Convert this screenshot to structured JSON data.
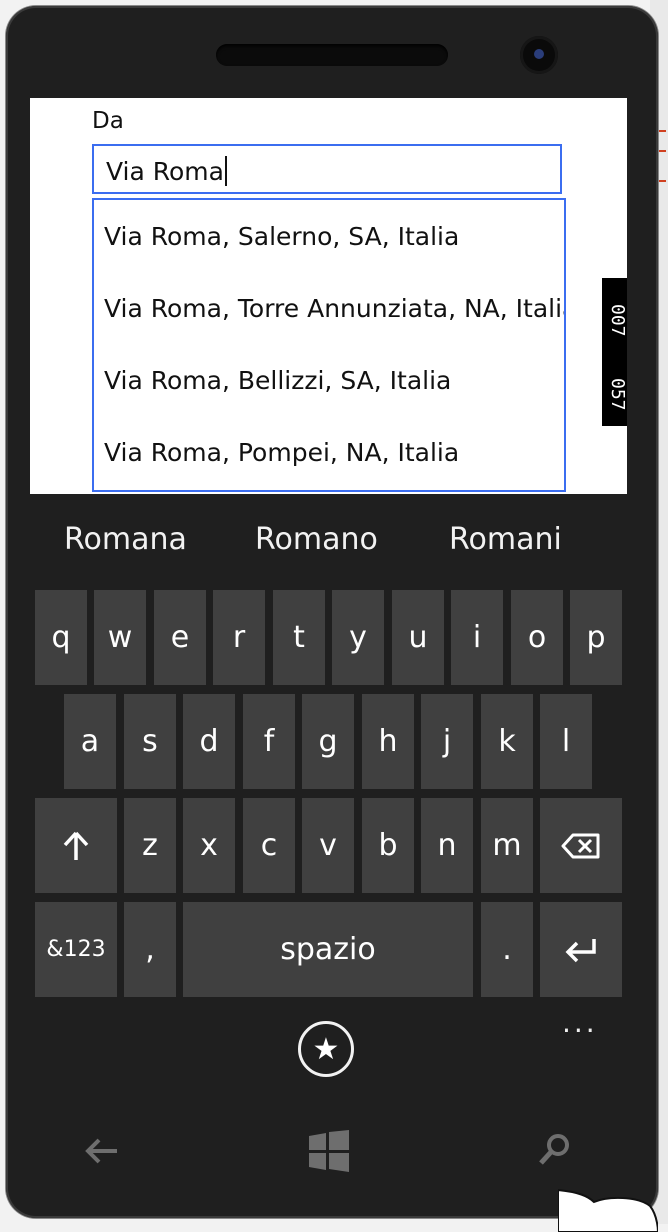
{
  "app": {
    "field_label": "Da",
    "input_value": "Via Roma",
    "suggestions": [
      "Via Roma, Salerno, SA, Italia",
      "Via Roma, Torre Annunziata, NA, Italia",
      "Via Roma, Bellizzi, SA, Italia",
      "Via Roma, Pompei, NA, Italia"
    ],
    "side_tag": [
      "007",
      "057"
    ]
  },
  "keyboard": {
    "word_suggestions": [
      "Romana",
      "Romano",
      "Romani"
    ],
    "row1": [
      "q",
      "w",
      "e",
      "r",
      "t",
      "y",
      "u",
      "i",
      "o",
      "p"
    ],
    "row2": [
      "a",
      "s",
      "d",
      "f",
      "g",
      "h",
      "j",
      "k",
      "l"
    ],
    "row3": [
      "z",
      "x",
      "c",
      "v",
      "b",
      "n",
      "m"
    ],
    "shift_icon": "shift-up-arrow-icon",
    "backspace_icon": "backspace-icon",
    "numbers_label": "&123",
    "comma_label": ",",
    "space_label": "spazio",
    "period_label": ".",
    "enter_icon": "enter-icon",
    "more_label": "...",
    "emoji_icon": "star-emoji-icon"
  },
  "hardware": {
    "back_icon": "back-arrow-icon",
    "start_icon": "windows-logo-icon",
    "search_icon": "search-icon"
  },
  "colors": {
    "accent": "#3b6df0",
    "key_bg": "#404040",
    "keyboard_bg": "#1f1f1f"
  }
}
